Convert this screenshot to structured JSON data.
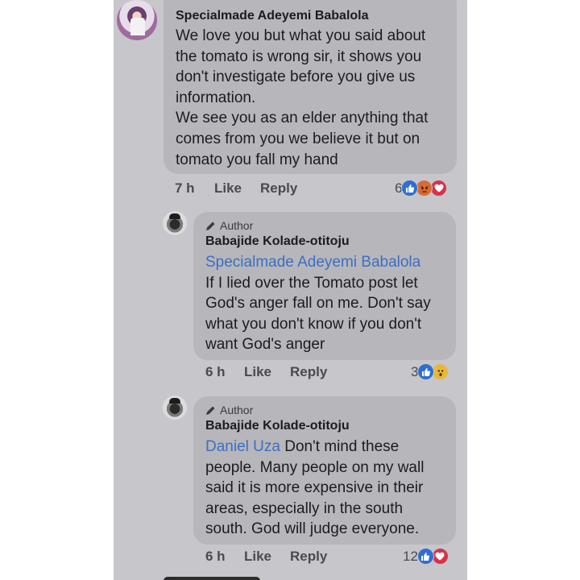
{
  "comments": [
    {
      "name": "Specialmade Adeyemi Babalola",
      "paragraphs": [
        "We love you but what you said about the tomato is wrong sir, it shows you don't investigate before you give us information.",
        "We see you as an elder anything that comes from you we believe it but on tomato you fall my hand"
      ],
      "time": "7 h",
      "like_label": "Like",
      "reply_label": "Reply",
      "reaction_count": "6",
      "reactions": [
        "like-icon",
        "angry-icon",
        "love-icon"
      ]
    }
  ],
  "replies": [
    {
      "author_tag": "Author",
      "name": "Babajide Kolade-otitoju",
      "mention": "Specialmade Adeyemi Babalola",
      "text": "If I lied over the Tomato post let God's anger fall on me. Don't say what you don't know if you don't want God's anger",
      "time": "6 h",
      "like_label": "Like",
      "reply_label": "Reply",
      "reaction_count": "3",
      "reactions": [
        "like-icon",
        "wow-icon"
      ]
    },
    {
      "author_tag": "Author",
      "name": "Babajide Kolade-otitoju",
      "mention": "Daniel Uza",
      "text": "Don't mind these people. Many people on my wall said it is more expensive in their areas, especially in the south south. God will judge everyone.",
      "time": "6 h",
      "like_label": "Like",
      "reply_label": "Reply",
      "reaction_count": "12",
      "reactions": [
        "like-icon",
        "love-icon"
      ]
    }
  ],
  "colors": {
    "background": "#c7c6cb",
    "bubble": "#b7b6bb",
    "mention": "#3c6fc2",
    "like": "#2f6fcf",
    "love": "#d8324a",
    "angry": "#d96a32",
    "wow": "#e8b73a"
  }
}
